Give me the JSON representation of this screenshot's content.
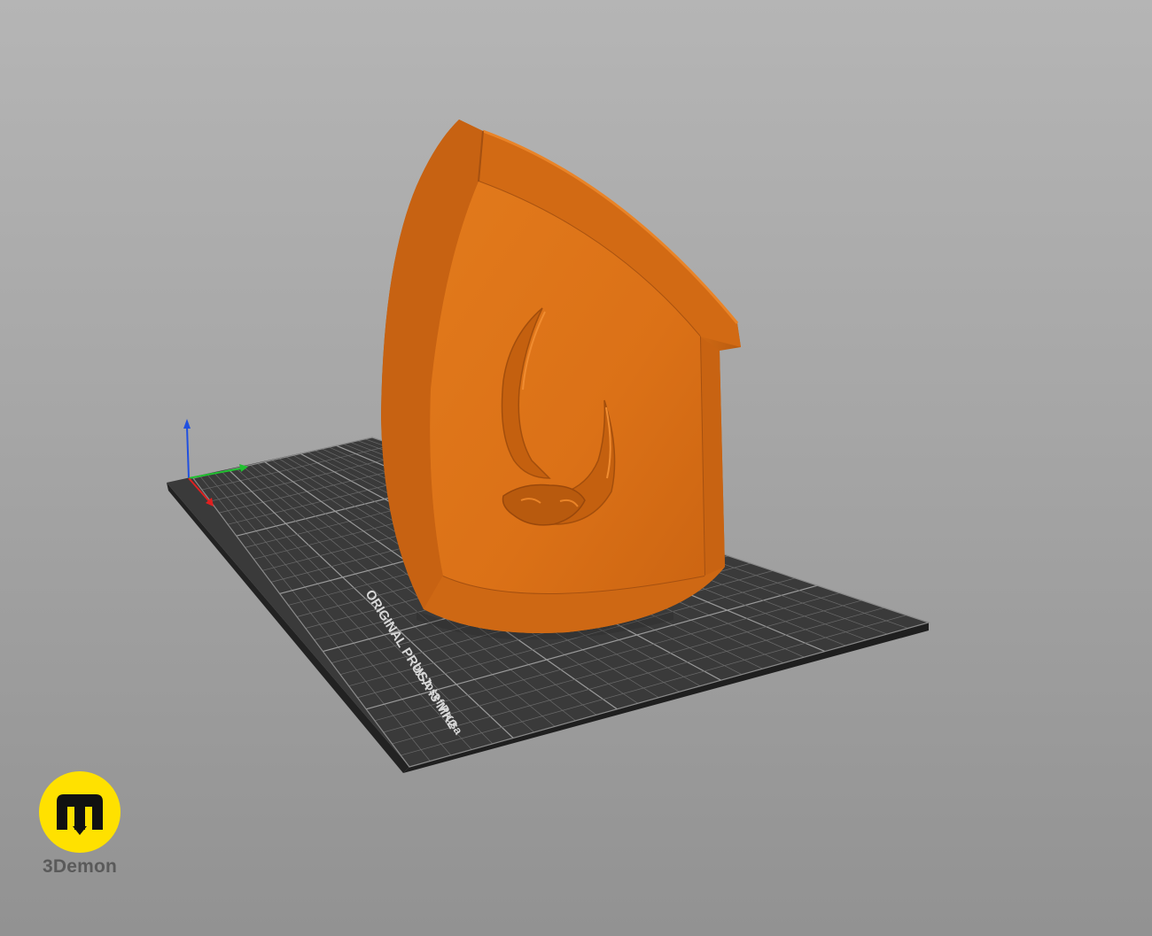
{
  "app": {
    "view": "3D print preview",
    "colors": {
      "background_top": "#b5b5b5",
      "background_bottom": "#929292",
      "bed": "#3a3a3a",
      "bed_edge": "#262626",
      "grid": "#7d7d7d",
      "model": "#d96f15",
      "axis_x": "#e02020",
      "axis_y": "#20c030",
      "axis_z": "#2050e0",
      "brand_yellow": "#ffe100"
    }
  },
  "bed": {
    "label_line1": "ORIGINAL PRUSA i3 MK2",
    "label_line2": "by Josef Prusa"
  },
  "axes": {
    "icon": "xyz-axes-gizmo"
  },
  "model": {
    "description_icon": "mandalorian-mudhorn-bracer-model",
    "emblem_icon": "mudhorn-skull-emblem"
  },
  "brand": {
    "logo_icon": "3demon-logo",
    "name": "3Demon"
  }
}
